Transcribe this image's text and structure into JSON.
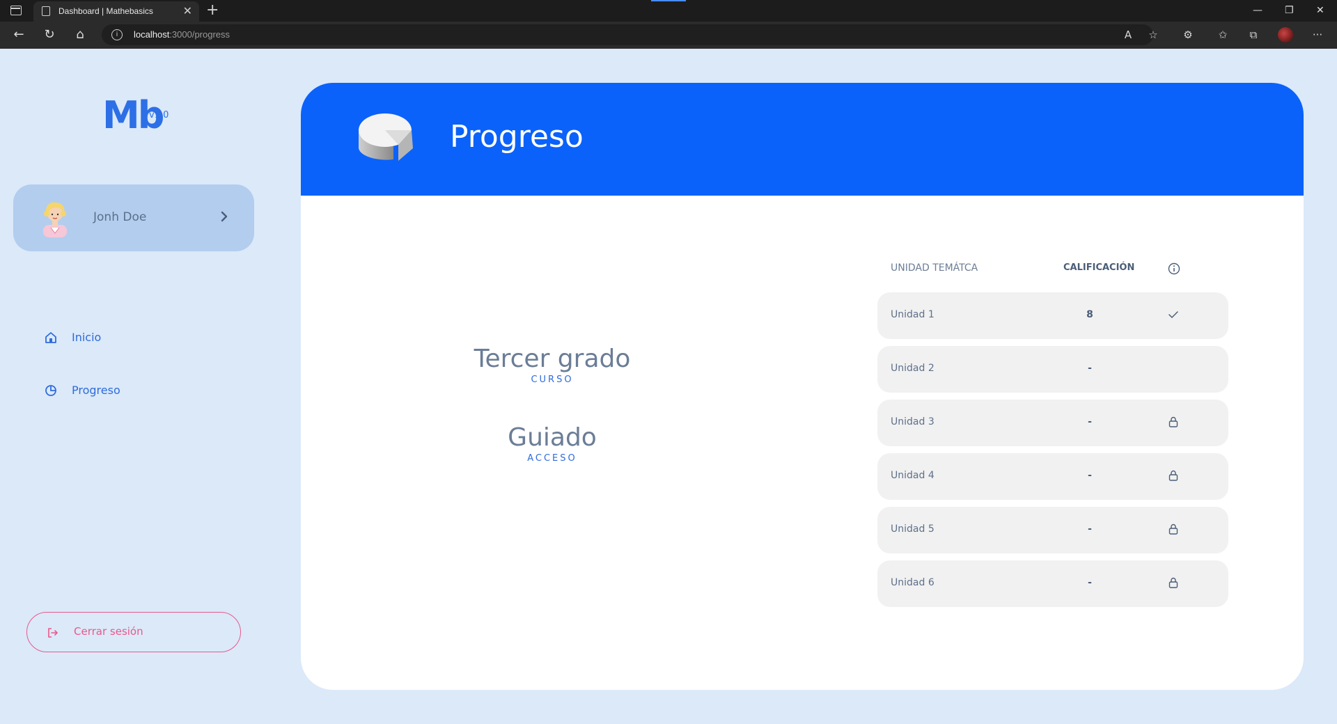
{
  "browser": {
    "tab_title": "Dashboard | Mathebasics",
    "url_host": "localhost",
    "url_rest": ":3000/progress"
  },
  "sidebar": {
    "logo_text": "Mb",
    "version": "v1.0",
    "user_name": "Jonh Doe",
    "nav": [
      {
        "label": "Inicio",
        "icon": "home-icon"
      },
      {
        "label": "Progreso",
        "icon": "pie-chart-icon"
      }
    ],
    "logout_label": "Cerrar sesión"
  },
  "main": {
    "title": "Progreso",
    "course_value": "Tercer grado",
    "course_label": "CURSO",
    "access_value": "Guiado",
    "access_label": "ACCESO",
    "table": {
      "col_unit": "UNIDAD TEMÁTCA",
      "col_grade": "CALIFICACIÓN",
      "rows": [
        {
          "unit": "Unidad 1",
          "grade": "8",
          "status": "check"
        },
        {
          "unit": "Unidad 2",
          "grade": "-",
          "status": "none"
        },
        {
          "unit": "Unidad 3",
          "grade": "-",
          "status": "locked"
        },
        {
          "unit": "Unidad 4",
          "grade": "-",
          "status": "locked"
        },
        {
          "unit": "Unidad 5",
          "grade": "-",
          "status": "locked"
        },
        {
          "unit": "Unidad 6",
          "grade": "-",
          "status": "locked"
        }
      ]
    }
  },
  "colors": {
    "accent": "#0a62fa",
    "background": "#dbe9f9",
    "logout": "#e8598a"
  }
}
